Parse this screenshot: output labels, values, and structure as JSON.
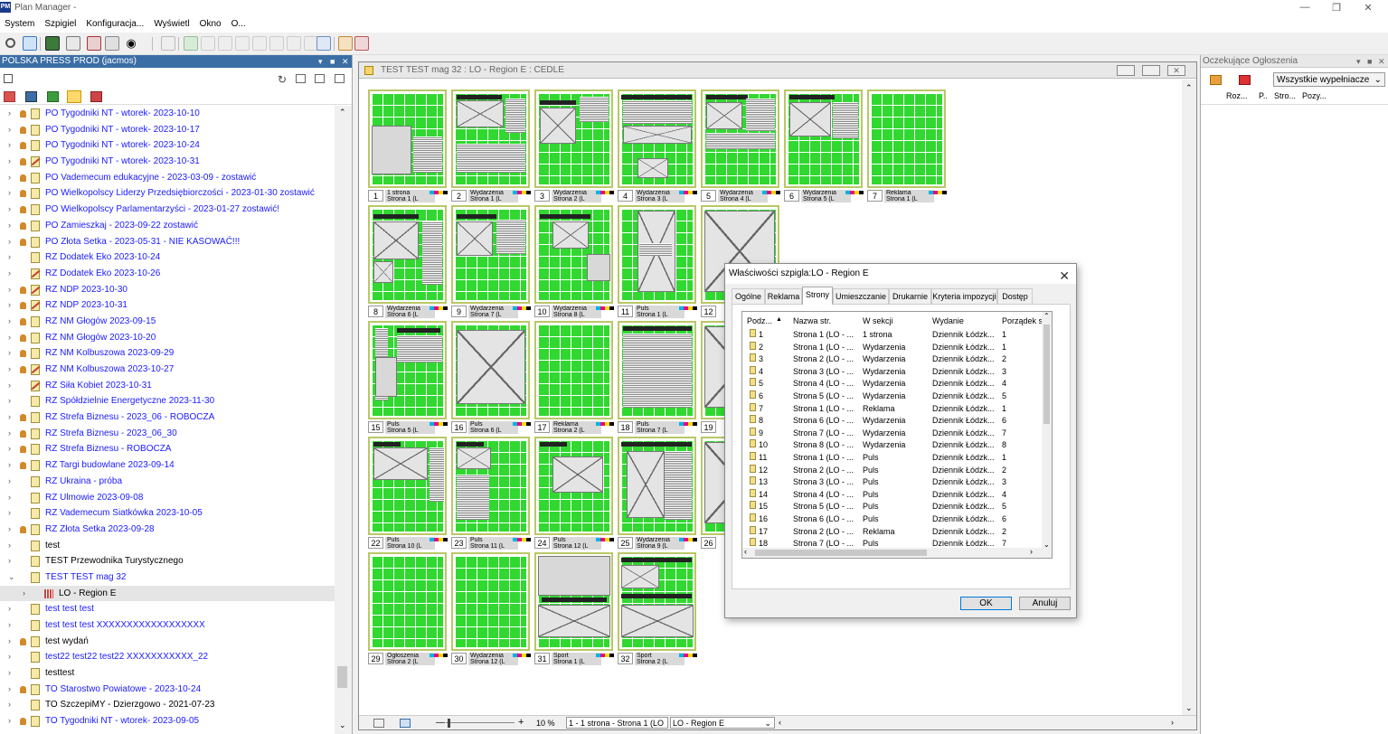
{
  "app": {
    "title": "Plan Manager -",
    "icon": "PM"
  },
  "menu": [
    "System",
    "Szpigiel",
    "Konfiguracja...",
    "Wyświetl",
    "Okno",
    "O..."
  ],
  "left_panel": {
    "title": "POLSKA PRESS PROD  (jacmos)",
    "tree": [
      {
        "label": "PO Tygodniki NT - wtorek- 2023-10-10",
        "bell": true,
        "x": false,
        "color": "blue"
      },
      {
        "label": "PO Tygodniki NT - wtorek- 2023-10-17",
        "bell": true,
        "x": false,
        "color": "blue"
      },
      {
        "label": "PO Tygodniki NT - wtorek- 2023-10-24",
        "bell": true,
        "x": false,
        "color": "blue"
      },
      {
        "label": "PO Tygodniki NT - wtorek- 2023-10-31",
        "bell": true,
        "x": true,
        "color": "blue"
      },
      {
        "label": "PO Vademecum edukacyjne - 2023-03-09 - zostawić",
        "bell": true,
        "x": false,
        "color": "blue"
      },
      {
        "label": "PO Wielkopolscy Liderzy Przedsiębiorczości - 2023-01-30 zostawić",
        "bell": true,
        "x": false,
        "color": "blue"
      },
      {
        "label": "PO Wielkopolscy Parlamentarzyści - 2023-01-27 zostawić!",
        "bell": true,
        "x": false,
        "color": "blue"
      },
      {
        "label": "PO Zamieszkaj - 2023-09-22 zostawić",
        "bell": true,
        "x": false,
        "color": "blue"
      },
      {
        "label": "PO Złota Setka - 2023-05-31 - NIE KASOWAĆ!!!",
        "bell": true,
        "x": false,
        "color": "blue"
      },
      {
        "label": "RZ Dodatek Eko 2023-10-24",
        "bell": false,
        "x": false,
        "color": "blue"
      },
      {
        "label": "RZ Dodatek Eko 2023-10-26",
        "bell": false,
        "x": true,
        "color": "blue"
      },
      {
        "label": "RZ NDP 2023-10-30",
        "bell": true,
        "x": true,
        "color": "blue"
      },
      {
        "label": "RZ NDP 2023-10-31",
        "bell": true,
        "x": true,
        "color": "blue"
      },
      {
        "label": "RZ NM Głogów 2023-09-15",
        "bell": true,
        "x": false,
        "color": "blue"
      },
      {
        "label": "RZ NM Głogów 2023-10-20",
        "bell": true,
        "x": false,
        "color": "blue"
      },
      {
        "label": "RZ NM Kolbuszowa 2023-09-29",
        "bell": true,
        "x": false,
        "color": "blue"
      },
      {
        "label": "RZ NM Kolbuszowa 2023-10-27",
        "bell": true,
        "x": true,
        "color": "blue"
      },
      {
        "label": "RZ Siła Kobiet 2023-10-31",
        "bell": false,
        "x": true,
        "color": "blue"
      },
      {
        "label": "RZ Spółdzielnie Energetyczne 2023-11-30",
        "bell": false,
        "x": false,
        "color": "blue"
      },
      {
        "label": "RZ Strefa Biznesu - 2023_06 - ROBOCZA",
        "bell": true,
        "x": false,
        "color": "blue"
      },
      {
        "label": "RZ Strefa Biznesu - 2023_06_30",
        "bell": true,
        "x": false,
        "color": "blue"
      },
      {
        "label": "RZ Strefa Biznesu - ROBOCZA",
        "bell": true,
        "x": false,
        "color": "blue"
      },
      {
        "label": "RZ Targi budowlane 2023-09-14",
        "bell": true,
        "x": false,
        "color": "blue"
      },
      {
        "label": "RZ Ukraina - próba",
        "bell": false,
        "x": false,
        "color": "blue"
      },
      {
        "label": "RZ Ulmowie 2023-09-08",
        "bell": false,
        "x": false,
        "color": "blue"
      },
      {
        "label": "RZ Vademecum Siatkówka 2023-10-05",
        "bell": false,
        "x": false,
        "color": "blue"
      },
      {
        "label": "RZ Złota Setka 2023-09-28",
        "bell": true,
        "x": false,
        "color": "blue"
      },
      {
        "label": "test",
        "bell": false,
        "x": false,
        "color": "black"
      },
      {
        "label": "TEST Przewodnika Turystycznego",
        "bell": false,
        "x": false,
        "color": "black"
      },
      {
        "label": "TEST TEST mag 32",
        "bell": false,
        "x": false,
        "color": "blue",
        "expanded": true
      },
      {
        "label": "LO - Region E",
        "child": true
      },
      {
        "label": "test test test",
        "bell": false,
        "x": false,
        "color": "blue"
      },
      {
        "label": "test test test XXXXXXXXXXXXXXXXXX",
        "bell": false,
        "x": false,
        "color": "blue"
      },
      {
        "label": "test wydań",
        "bell": true,
        "x": false,
        "color": "black"
      },
      {
        "label": "test22 test22 test22 XXXXXXXXXXX_22",
        "bell": false,
        "x": false,
        "color": "blue"
      },
      {
        "label": "testtest",
        "bell": false,
        "x": false,
        "color": "black"
      },
      {
        "label": "TO Starostwo Powiatowe - 2023-10-24",
        "bell": true,
        "x": false,
        "color": "blue"
      },
      {
        "label": "TO SzczepiMY - Dzierzgowo - 2021-07-23",
        "bell": false,
        "x": false,
        "color": "black"
      },
      {
        "label": "TO Tygodniki NT - wtorek- 2023-09-05",
        "bell": true,
        "x": false,
        "color": "blue"
      }
    ]
  },
  "mdi": {
    "title": "TEST TEST mag 32 : LO - Region E : CEDLE",
    "pages": [
      {
        "n": "1",
        "sec": "1 strona",
        "sub": "Strona 1 (L"
      },
      {
        "n": "2",
        "sec": "Wydarzenia",
        "sub": "Strona 1 (L"
      },
      {
        "n": "3",
        "sec": "Wydarzenia",
        "sub": "Strona 2 (L"
      },
      {
        "n": "4",
        "sec": "Wydarzenia",
        "sub": "Strona 3 (L"
      },
      {
        "n": "5",
        "sec": "Wydarzenia",
        "sub": "Strona 4 (L"
      },
      {
        "n": "6",
        "sec": "Wydarzenia",
        "sub": "Strona 5 (L"
      },
      {
        "n": "7",
        "sec": "Reklama",
        "sub": "Strona 1 (L"
      },
      {
        "n": "8",
        "sec": "Wydarzenia",
        "sub": "Strona 6 (L"
      },
      {
        "n": "9",
        "sec": "Wydarzenia",
        "sub": "Strona 7 (L"
      },
      {
        "n": "10",
        "sec": "Wydarzenia",
        "sub": "Strona 8 (L"
      },
      {
        "n": "11",
        "sec": "Puls",
        "sub": "Strona 1 (L"
      },
      {
        "n": "12",
        "sec": "",
        "sub": ""
      },
      {
        "n": "15",
        "sec": "Puls",
        "sub": "Strona 5 (L"
      },
      {
        "n": "16",
        "sec": "Puls",
        "sub": "Strona 6 (L"
      },
      {
        "n": "17",
        "sec": "Reklama",
        "sub": "Strona 2 (L"
      },
      {
        "n": "18",
        "sec": "Puls",
        "sub": "Strona 7 (L"
      },
      {
        "n": "19",
        "sec": "",
        "sub": ""
      },
      {
        "n": "22",
        "sec": "Puls",
        "sub": "Strona 10 (L"
      },
      {
        "n": "23",
        "sec": "Puls",
        "sub": "Strona 11 (L"
      },
      {
        "n": "24",
        "sec": "Puls",
        "sub": "Strona 12 (L"
      },
      {
        "n": "25",
        "sec": "Wydarzenia",
        "sub": "Strona 9 (L"
      },
      {
        "n": "26",
        "sec": "",
        "sub": ""
      },
      {
        "n": "29",
        "sec": "Ogłoszenia",
        "sub": "Strona 2 (L"
      },
      {
        "n": "30",
        "sec": "Wydarzenia",
        "sub": "Strona 12 (L"
      },
      {
        "n": "31",
        "sec": "Sport",
        "sub": "Strona 1 (L"
      },
      {
        "n": "32",
        "sec": "Sport",
        "sub": "Strona 2 (L"
      }
    ],
    "zoom": "10 %",
    "page_select": "1 - 1 strona - Strona 1 (LO",
    "region_select": "LO - Region E"
  },
  "right_panel": {
    "title": "Oczekujące Ogłoszenia",
    "filter": "Wszystkie wypełniacze",
    "columns": [
      "Roz...",
      "P..",
      "Stro...",
      "Pozy..."
    ]
  },
  "dialog": {
    "title": "Właściwości szpigla:LO - Region E",
    "tabs": [
      "Ogólne",
      "Reklama",
      "Strony",
      "Umieszczanie",
      "Drukarnie",
      "Kryteria impozycji",
      "Dostęp"
    ],
    "active_tab": "Strony",
    "columns": [
      "Podz...",
      "Nazwa str.",
      "W sekcji",
      "Wydanie",
      "Porządek s"
    ],
    "rows": [
      [
        "1",
        "Strona 1 (LO - ...",
        "1 strona",
        "Dziennik Łódzk...",
        "1"
      ],
      [
        "2",
        "Strona 1 (LO - ...",
        "Wydarzenia",
        "Dziennik Łódzk...",
        "1"
      ],
      [
        "3",
        "Strona 2 (LO - ...",
        "Wydarzenia",
        "Dziennik Łódzk...",
        "2"
      ],
      [
        "4",
        "Strona 3 (LO - ...",
        "Wydarzenia",
        "Dziennik Łódzk...",
        "3"
      ],
      [
        "5",
        "Strona 4 (LO - ...",
        "Wydarzenia",
        "Dziennik Łódzk...",
        "4"
      ],
      [
        "6",
        "Strona 5 (LO - ...",
        "Wydarzenia",
        "Dziennik Łódzk...",
        "5"
      ],
      [
        "7",
        "Strona 1 (LO - ...",
        "Reklama",
        "Dziennik Łódzk...",
        "1"
      ],
      [
        "8",
        "Strona 6 (LO - ...",
        "Wydarzenia",
        "Dziennik Łódzk...",
        "6"
      ],
      [
        "9",
        "Strona 7 (LO - ...",
        "Wydarzenia",
        "Dziennik Łódzk...",
        "7"
      ],
      [
        "10",
        "Strona 8 (LO - ...",
        "Wydarzenia",
        "Dziennik Łódzk...",
        "8"
      ],
      [
        "11",
        "Strona 1 (LO - ...",
        "Puls",
        "Dziennik Łódzk...",
        "1"
      ],
      [
        "12",
        "Strona 2 (LO - ...",
        "Puls",
        "Dziennik Łódzk...",
        "2"
      ],
      [
        "13",
        "Strona 3 (LO - ...",
        "Puls",
        "Dziennik Łódzk...",
        "3"
      ],
      [
        "14",
        "Strona 4 (LO - ...",
        "Puls",
        "Dziennik Łódzk...",
        "4"
      ],
      [
        "15",
        "Strona 5 (LO - ...",
        "Puls",
        "Dziennik Łódzk...",
        "5"
      ],
      [
        "16",
        "Strona 6 (LO - ...",
        "Puls",
        "Dziennik Łódzk...",
        "6"
      ],
      [
        "17",
        "Strona 2 (LO - ...",
        "Reklama",
        "Dziennik Łódzk...",
        "2"
      ],
      [
        "18",
        "Strona 7 (LO - ...",
        "Puls",
        "Dziennik Łódzk...",
        "7"
      ]
    ],
    "ok": "OK",
    "cancel": "Anuluj"
  }
}
